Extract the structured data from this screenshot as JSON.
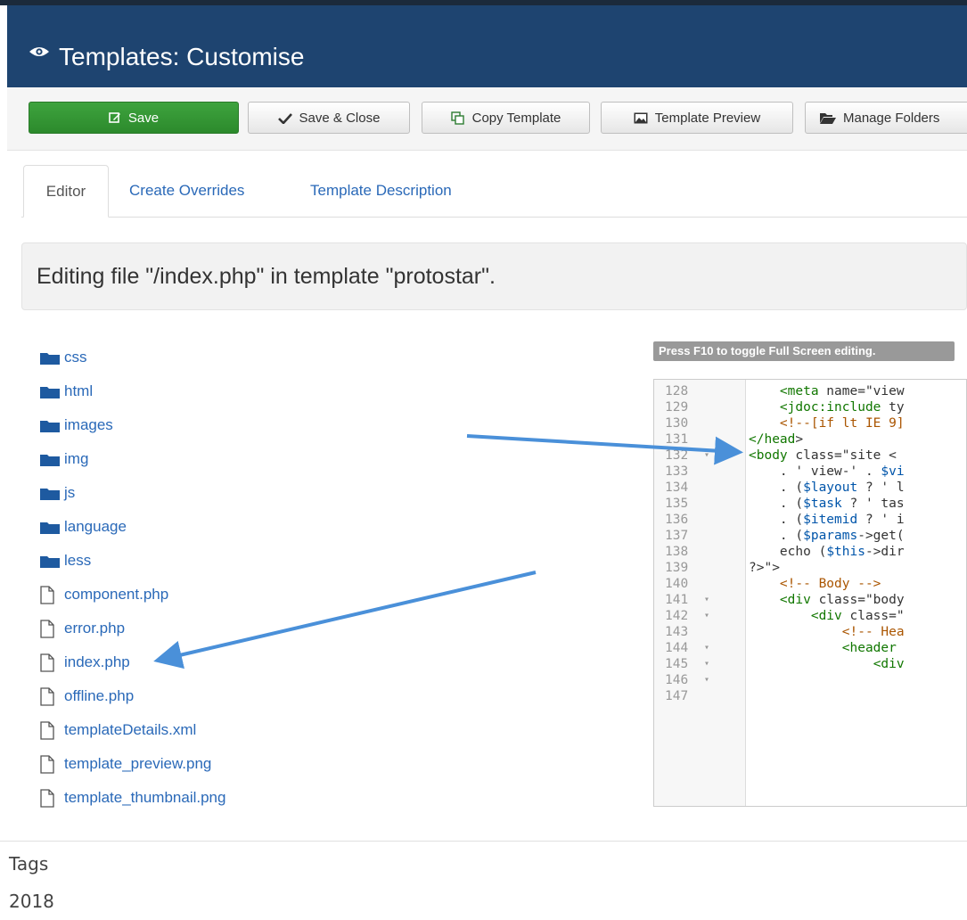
{
  "header": {
    "title": "Templates: Customise",
    "icon": "eye-icon"
  },
  "toolbar": {
    "save_label": "Save",
    "save_close_label": "Save & Close",
    "copy_label": "Copy Template",
    "preview_label": "Template Preview",
    "folders_label": "Manage Folders"
  },
  "tabs": [
    {
      "label": "Editor",
      "active": true
    },
    {
      "label": "Create Overrides",
      "active": false
    },
    {
      "label": "Template Description",
      "active": false
    }
  ],
  "notice": "Editing file \"/index.php\" in template \"protostar\".",
  "files": [
    {
      "name": "css",
      "type": "folder"
    },
    {
      "name": "html",
      "type": "folder"
    },
    {
      "name": "images",
      "type": "folder"
    },
    {
      "name": "img",
      "type": "folder"
    },
    {
      "name": "js",
      "type": "folder"
    },
    {
      "name": "language",
      "type": "folder"
    },
    {
      "name": "less",
      "type": "folder"
    },
    {
      "name": "component.php",
      "type": "file"
    },
    {
      "name": "error.php",
      "type": "file"
    },
    {
      "name": "index.php",
      "type": "file"
    },
    {
      "name": "offline.php",
      "type": "file"
    },
    {
      "name": "templateDetails.xml",
      "type": "file"
    },
    {
      "name": "template_preview.png",
      "type": "file"
    },
    {
      "name": "template_thumbnail.png",
      "type": "file"
    }
  ],
  "editor": {
    "hint": "Press F10 to toggle Full Screen editing.",
    "lines": [
      {
        "num": "128",
        "fold": false,
        "code": "    <meta name=\"view"
      },
      {
        "num": "129",
        "fold": false,
        "code": "    <jdoc:include ty"
      },
      {
        "num": "130",
        "fold": false,
        "code": "    <!--[if lt IE 9]"
      },
      {
        "num": "131",
        "fold": false,
        "code": "</head>"
      },
      {
        "num": "132",
        "fold": true,
        "code": "<body class=\"site <"
      },
      {
        "num": "133",
        "fold": false,
        "code": "    . ' view-' . $vi"
      },
      {
        "num": "134",
        "fold": false,
        "code": "    . ($layout ? ' l"
      },
      {
        "num": "135",
        "fold": false,
        "code": "    . ($task ? ' tas"
      },
      {
        "num": "136",
        "fold": false,
        "code": "    . ($itemid ? ' i"
      },
      {
        "num": "137",
        "fold": false,
        "code": "    . ($params->get("
      },
      {
        "num": "138",
        "fold": false,
        "code": "    echo ($this->dir"
      },
      {
        "num": "139",
        "fold": false,
        "code": "?>\">"
      },
      {
        "num": "140",
        "fold": false,
        "code": "    <!-- Body -->"
      },
      {
        "num": "141",
        "fold": true,
        "code": "    <div class=\"body"
      },
      {
        "num": "142",
        "fold": true,
        "code": "        <div class=\""
      },
      {
        "num": "143",
        "fold": false,
        "code": "            <!-- Hea"
      },
      {
        "num": "144",
        "fold": true,
        "code": "            <header "
      },
      {
        "num": "145",
        "fold": true,
        "code": "                <div"
      },
      {
        "num": "146",
        "fold": true,
        "code": ""
      },
      {
        "num": "147",
        "fold": false,
        "code": ""
      }
    ]
  },
  "footer": {
    "tags_label": "Tags",
    "tags_value": "2018"
  },
  "colors": {
    "header_bg": "#1e4470",
    "save_green": "#2c8a2c",
    "link_blue": "#2a69b8",
    "arrow_blue": "#4a90d9"
  }
}
